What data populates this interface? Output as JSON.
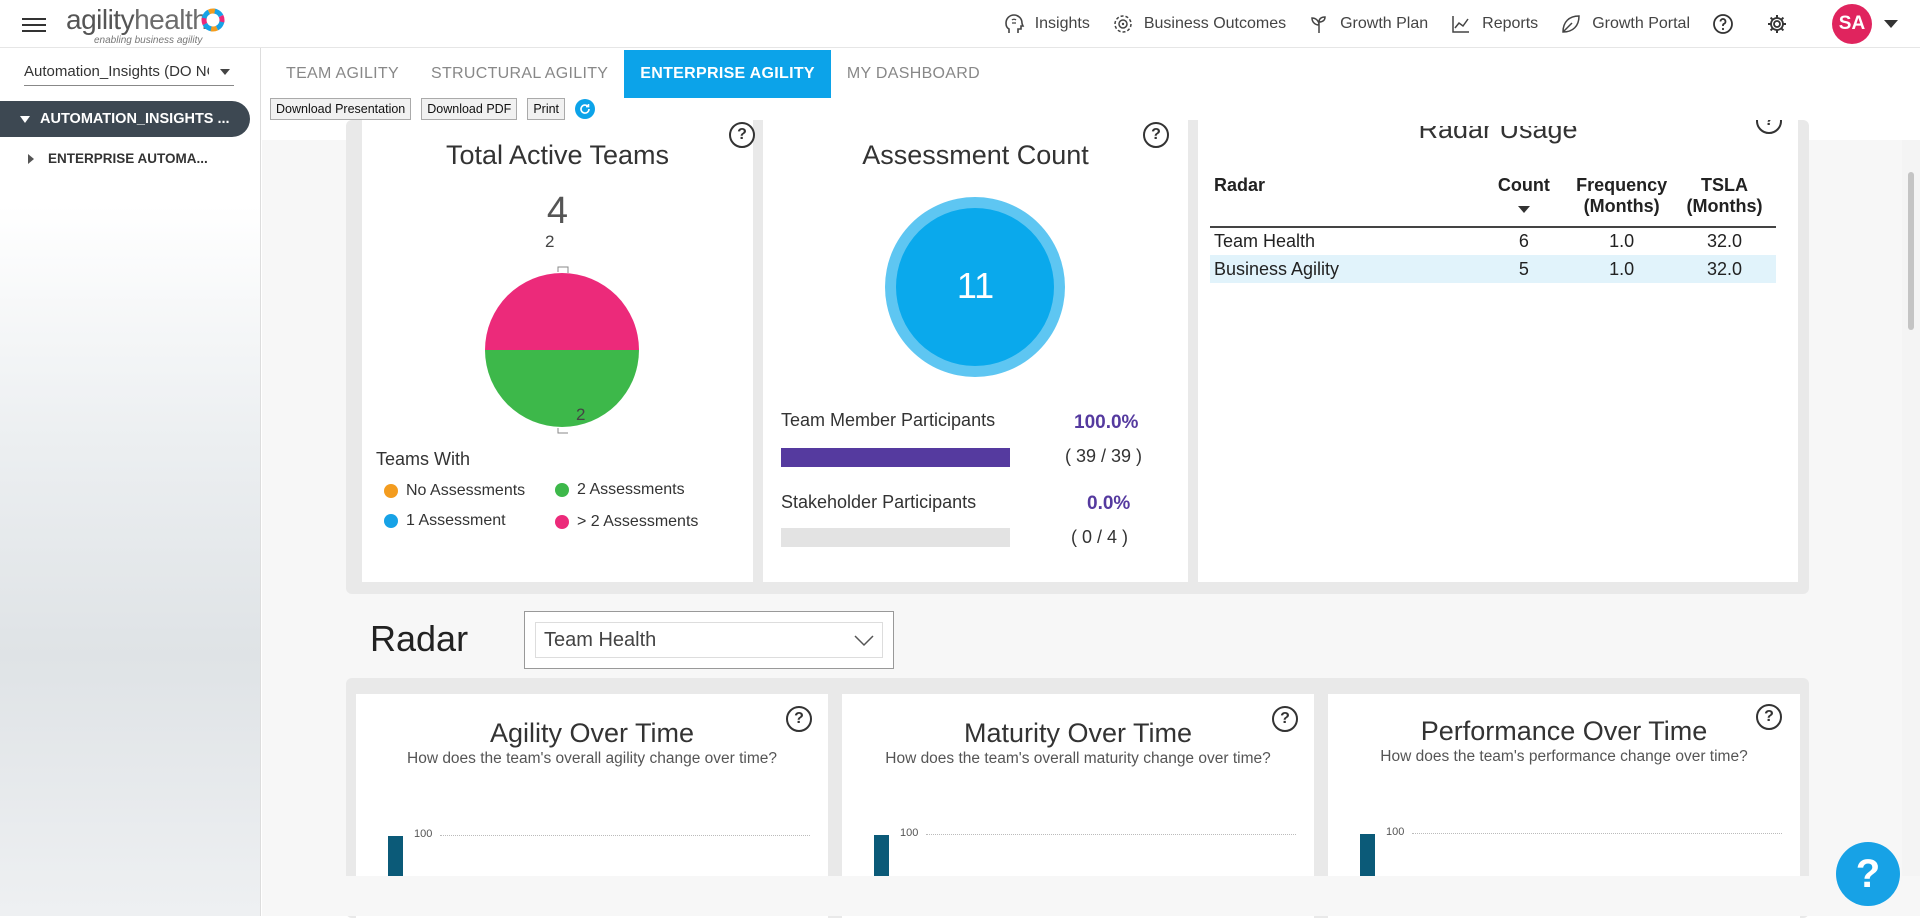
{
  "brand": {
    "name_a": "agility",
    "name_b": "health",
    "tagline": "enabling business agility"
  },
  "nav": {
    "items": [
      {
        "label": "Insights",
        "icon": "brain-head-icon"
      },
      {
        "label": "Business Outcomes",
        "icon": "target-icon"
      },
      {
        "label": "Growth Plan",
        "icon": "sprout-icon"
      },
      {
        "label": "Reports",
        "icon": "line-chart-icon"
      },
      {
        "label": "Growth Portal",
        "icon": "leaf-icon"
      }
    ],
    "user_initials": "SA"
  },
  "sidebar": {
    "team_select": "Automation_Insights (DO NOT",
    "tree_root": "AUTOMATION_INSIGHTS ...",
    "tree_child": "ENTERPRISE AUTOMA..."
  },
  "tabs": [
    {
      "label": "TEAM AGILITY",
      "active": false
    },
    {
      "label": "STRUCTURAL AGILITY",
      "active": false
    },
    {
      "label": "ENTERPRISE AGILITY",
      "active": true
    },
    {
      "label": "MY DASHBOARD",
      "active": false
    }
  ],
  "toolbar": {
    "download_presentation": "Download Presentation",
    "download_pdf": "Download PDF",
    "print": "Print"
  },
  "total_active_teams": {
    "title": "Total Active Teams",
    "count": "4",
    "pie": [
      {
        "label": "2",
        "value": 2,
        "color": "#ec2a7a"
      },
      {
        "label": "2",
        "value": 2,
        "color": "#3db84a"
      }
    ],
    "legend_title": "Teams With",
    "legend": [
      {
        "label": "No Assessments",
        "color": "#f39c1f"
      },
      {
        "label": "2 Assessments",
        "color": "#3db84a"
      },
      {
        "label": "1 Assessment",
        "color": "#17a2e6"
      },
      {
        "label": "> 2  Assessments",
        "color": "#ec2a7a"
      }
    ]
  },
  "assessment_count": {
    "title": "Assessment Count",
    "count": "11",
    "team_member": {
      "label": "Team Member Participants",
      "pct": "100.0%",
      "counts": "( 39 / 39 )",
      "fraction": 1.0
    },
    "stakeholder": {
      "label": "Stakeholder Participants",
      "pct": "0.0%",
      "counts": "( 0 / 4 )",
      "fraction": 0.0
    }
  },
  "radar_usage": {
    "title": "Radar Usage",
    "headers": {
      "radar": "Radar",
      "count": "Count",
      "freq1": "Frequency",
      "freq2": "(Months)",
      "tsla1": "TSLA",
      "tsla2": "(Months)"
    },
    "rows": [
      {
        "radar": "Team Health",
        "count": "6",
        "freq": "1.0",
        "tsla": "32.0"
      },
      {
        "radar": "Business Agility",
        "count": "5",
        "freq": "1.0",
        "tsla": "32.0"
      }
    ]
  },
  "radar_section": {
    "heading": "Radar",
    "selected": "Team Health"
  },
  "over_time": [
    {
      "title": "Agility Over Time",
      "subtitle": "How does the team's overall agility change over time?",
      "tick": "100"
    },
    {
      "title": "Maturity Over Time",
      "subtitle": "How does the team's overall maturity change over time?",
      "tick": "100"
    },
    {
      "title": "Performance Over Time",
      "subtitle": "How does the team's performance change over time?",
      "tick": "100"
    }
  ],
  "help_fab": "?"
}
